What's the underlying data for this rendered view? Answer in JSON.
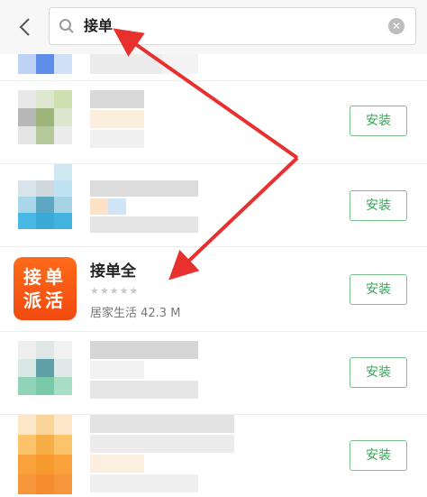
{
  "search": {
    "query": "接单"
  },
  "featured_app": {
    "logo_line1": "接单",
    "logo_line2": "派活",
    "name": "接单全",
    "rating_stars": "★★★★★",
    "meta": "居家生活 42.3 M"
  },
  "install_label": "安装",
  "colors": {
    "accent": "#3aa35a",
    "annotation": "#e8312f",
    "logo": "#f55a16"
  }
}
